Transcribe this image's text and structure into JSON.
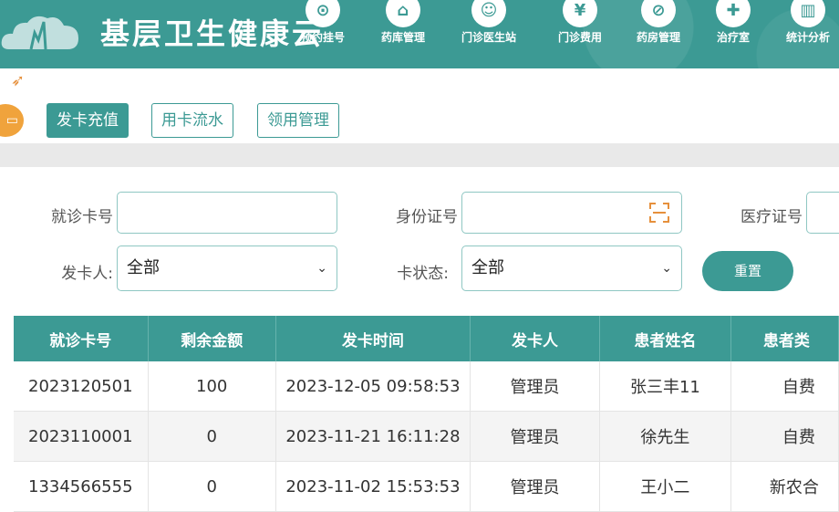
{
  "app": {
    "title": "基层卫生健康云"
  },
  "nav": [
    {
      "label": "预约挂号",
      "icon": "calendar-icon",
      "glyph": "⊙"
    },
    {
      "label": "药库管理",
      "icon": "warehouse-icon",
      "glyph": "⌂"
    },
    {
      "label": "门诊医生站",
      "icon": "doctor-icon",
      "glyph": "☺"
    },
    {
      "label": "门诊费用",
      "icon": "yen-icon",
      "glyph": "¥"
    },
    {
      "label": "药房管理",
      "icon": "pill-icon",
      "glyph": "⊘"
    },
    {
      "label": "治疗室",
      "icon": "treatment-icon",
      "glyph": "✚"
    },
    {
      "label": "统计分析",
      "icon": "chart-icon",
      "glyph": "▥"
    }
  ],
  "tabs": [
    {
      "label": "发卡充值",
      "active": true
    },
    {
      "label": "用卡流水",
      "active": false
    },
    {
      "label": "领用管理",
      "active": false
    }
  ],
  "filters": {
    "card_no_label": "就诊卡号",
    "id_no_label": "身份证号",
    "medical_no_label": "医疗证号",
    "issuer_label": "发卡人:",
    "issuer_value": "全部",
    "status_label": "卡状态:",
    "status_value": "全部",
    "reset_label": "重置"
  },
  "table": {
    "columns": [
      "就诊卡号",
      "剩余金额",
      "发卡时间",
      "发卡人",
      "患者姓名",
      "患者类"
    ],
    "rows": [
      [
        "2023120501",
        "100",
        "2023-12-05 09:58:53",
        "管理员",
        "张三丰11",
        "自费"
      ],
      [
        "2023110001",
        "0",
        "2023-11-21 16:11:28",
        "管理员",
        "徐先生",
        "自费"
      ],
      [
        "1334566555",
        "0",
        "2023-11-02 15:53:53",
        "管理员",
        "王小二",
        "新农合"
      ]
    ]
  }
}
